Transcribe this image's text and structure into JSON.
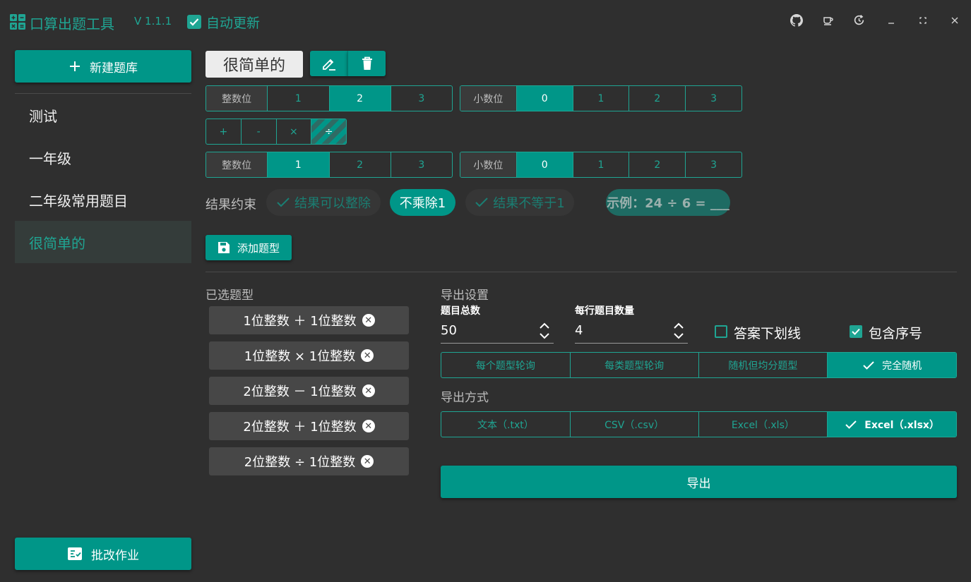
{
  "app": {
    "title": "口算出题工具",
    "version": "V 1.1.1",
    "auto_update_label": "自动更新",
    "auto_update_checked": true,
    "accent": "#009688"
  },
  "window_controls": [
    "github-icon",
    "coffee-icon",
    "update-icon",
    "minimize-icon",
    "maximize-icon",
    "close-icon"
  ],
  "sidebar": {
    "new_bank": "新建题库",
    "items": [
      {
        "label": "测试",
        "active": false
      },
      {
        "label": "一年级",
        "active": false
      },
      {
        "label": "二年级常用题目",
        "active": false
      },
      {
        "label": "很简单的",
        "active": true
      }
    ],
    "grade_button": "批改作业"
  },
  "editor": {
    "bank_name": "很简单的",
    "operand1": {
      "int_label": "整数位",
      "int_options": [
        "1",
        "2",
        "3"
      ],
      "int_selected": "2",
      "dec_label": "小数位",
      "dec_options": [
        "0",
        "1",
        "2",
        "3"
      ],
      "dec_selected": "0"
    },
    "operators": [
      "+",
      "-",
      "×",
      "÷"
    ],
    "operand2": {
      "int_label": "整数位",
      "int_options": [
        "1",
        "2",
        "3"
      ],
      "int_selected": "1",
      "dec_label": "小数位",
      "dec_options": [
        "0",
        "1",
        "2",
        "3"
      ],
      "dec_selected": "0"
    },
    "constraint_label": "结果约束",
    "constraints": {
      "divisible": "结果可以整除",
      "no_mul_div_one": "不乘除1",
      "not_equal_one": "结果不等于1"
    },
    "example": "示例：24 ÷ 6 = ___",
    "add_button": "添加题型"
  },
  "selected": {
    "title": "已选题型",
    "items": [
      "1位整数 ＋ 1位整数",
      "1位整数 × 1位整数",
      "2位整数 － 1位整数",
      "2位整数 ＋ 1位整数",
      "2位整数 ÷ 1位整数"
    ]
  },
  "export": {
    "settings_title": "导出设置",
    "total_label": "题目总数",
    "total_value": "50",
    "per_row_label": "每行题目数量",
    "per_row_value": "4",
    "underline_label": "答案下划线",
    "underline_checked": false,
    "index_label": "包含序号",
    "index_checked": true,
    "order_options": [
      "每个题型轮询",
      "每类题型轮询",
      "随机但均分题型",
      "完全随机"
    ],
    "order_selected": "完全随机",
    "method_title": "导出方式",
    "format_options": [
      "文本（.txt）",
      "CSV（.csv）",
      "Excel（.xls）",
      "Excel（.xlsx）"
    ],
    "format_selected": "Excel（.xlsx）",
    "export_button": "导出"
  }
}
